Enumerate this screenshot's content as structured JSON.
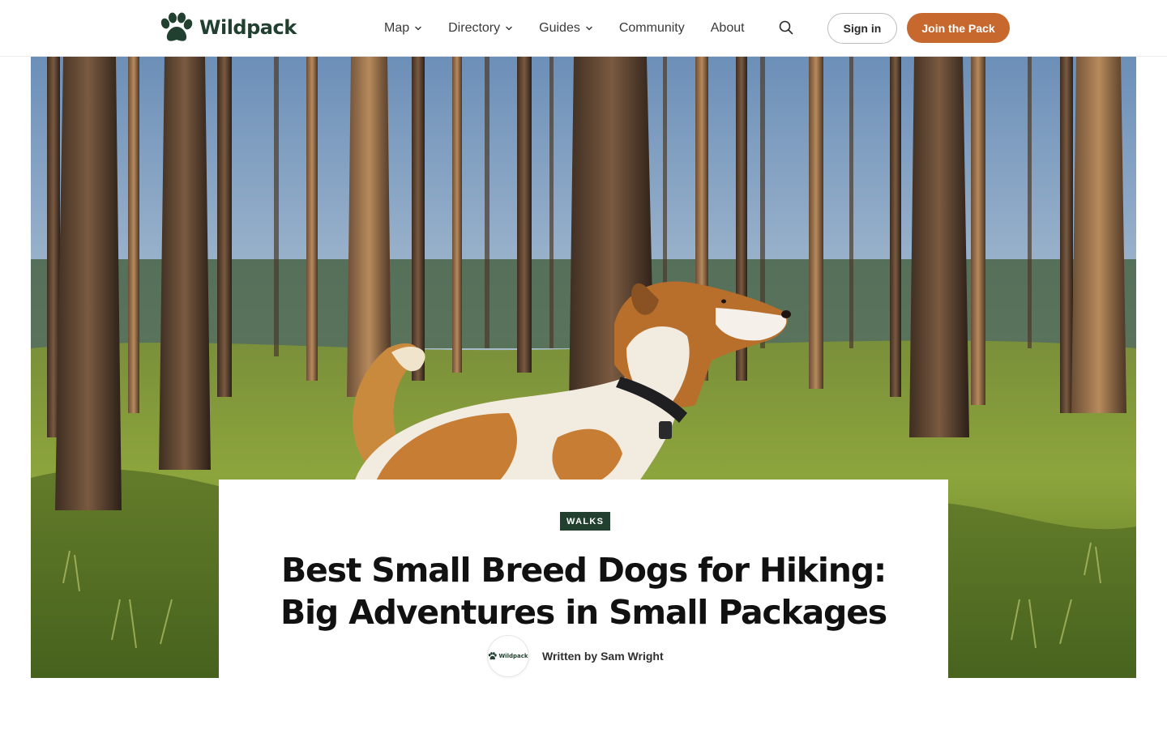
{
  "brand": {
    "name": "Wildpack",
    "color": "#21402f"
  },
  "nav": {
    "items": [
      {
        "label": "Map",
        "has_dropdown": true
      },
      {
        "label": "Directory",
        "has_dropdown": true
      },
      {
        "label": "Guides",
        "has_dropdown": true
      },
      {
        "label": "Community",
        "has_dropdown": false
      },
      {
        "label": "About",
        "has_dropdown": false
      }
    ],
    "search_icon": "search-icon",
    "signin_label": "Sign in",
    "join_label": "Join the Pack",
    "accent": "#c7692f"
  },
  "hero": {
    "image": "dog-in-pine-forest-photo"
  },
  "article": {
    "category": "WALKS",
    "title_line1": "Best Small Breed Dogs for Hiking:",
    "title_line2": "Big Adventures in Small Packages",
    "author_prefix": "Written by Sam Wright",
    "avatar_text": "Wildpack"
  }
}
